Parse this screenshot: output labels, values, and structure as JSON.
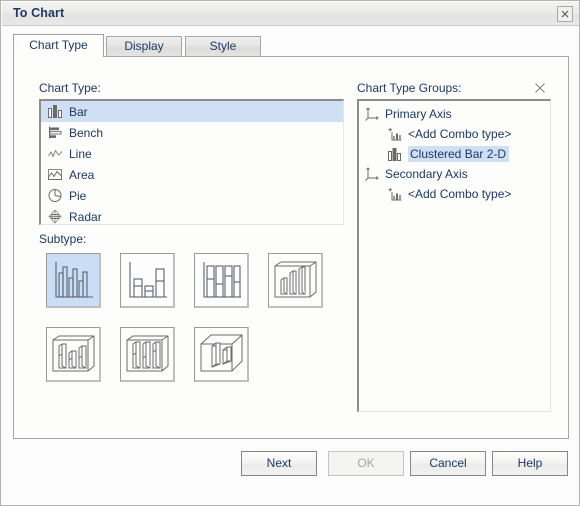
{
  "window": {
    "title": "To Chart",
    "close_icon": "close-icon"
  },
  "tabs": [
    {
      "id": "chart-type",
      "label": "Chart Type",
      "active": true
    },
    {
      "id": "display",
      "label": "Display",
      "active": false
    },
    {
      "id": "style",
      "label": "Style",
      "active": false
    }
  ],
  "chart_type": {
    "label": "Chart Type:",
    "items": [
      {
        "label": "Bar",
        "icon": "bar-chart-icon",
        "selected": true
      },
      {
        "label": "Bench",
        "icon": "bench-chart-icon",
        "selected": false
      },
      {
        "label": "Line",
        "icon": "line-chart-icon",
        "selected": false
      },
      {
        "label": "Area",
        "icon": "area-chart-icon",
        "selected": false
      },
      {
        "label": "Pie",
        "icon": "pie-chart-icon",
        "selected": false
      },
      {
        "label": "Radar",
        "icon": "radar-chart-icon",
        "selected": false
      }
    ]
  },
  "subtype": {
    "label": "Subtype:",
    "items": [
      {
        "name": "clustered-bar-2d",
        "icon": "clustered-bar-2d-icon",
        "selected": true
      },
      {
        "name": "stacked-bar-2d",
        "icon": "stacked-bar-2d-icon",
        "selected": false
      },
      {
        "name": "100-percent-stacked-bar-2d",
        "icon": "100-percent-stacked-bar-2d-icon",
        "selected": false
      },
      {
        "name": "clustered-bar-3d",
        "icon": "clustered-bar-3d-icon",
        "selected": false
      },
      {
        "name": "stacked-bar-3d",
        "icon": "stacked-bar-3d-icon",
        "selected": false
      },
      {
        "name": "100-percent-stacked-bar-3d",
        "icon": "100-percent-stacked-bar-3d-icon",
        "selected": false
      },
      {
        "name": "bar-3d-true",
        "icon": "bar-3d-true-icon",
        "selected": false
      }
    ]
  },
  "chart_type_groups": {
    "label": "Chart Type Groups:",
    "close_icon": "close-icon",
    "nodes": [
      {
        "label": "Primary Axis",
        "icon": "axis-icon",
        "level": 0,
        "selected": false
      },
      {
        "label": "<Add Combo type>",
        "icon": "add-combo-icon",
        "level": 1,
        "selected": false
      },
      {
        "label": "Clustered Bar 2-D",
        "icon": "bar-chart-icon",
        "level": 1,
        "selected": true
      },
      {
        "label": "Secondary Axis",
        "icon": "axis-icon",
        "level": 0,
        "selected": false
      },
      {
        "label": "<Add Combo type>",
        "icon": "add-combo-icon",
        "level": 1,
        "selected": false
      }
    ]
  },
  "footer": {
    "next_label": "Next",
    "ok_label": "OK",
    "ok_disabled": true,
    "cancel_label": "Cancel",
    "help_label": "Help"
  },
  "colors": {
    "selection_blue": "#cfe0f5",
    "subtype_selection_blue": "#c9ddf4",
    "text_navy": "#1f3864",
    "panel_bg": "#fdfefc",
    "disabled_text": "#a4a4a4"
  }
}
